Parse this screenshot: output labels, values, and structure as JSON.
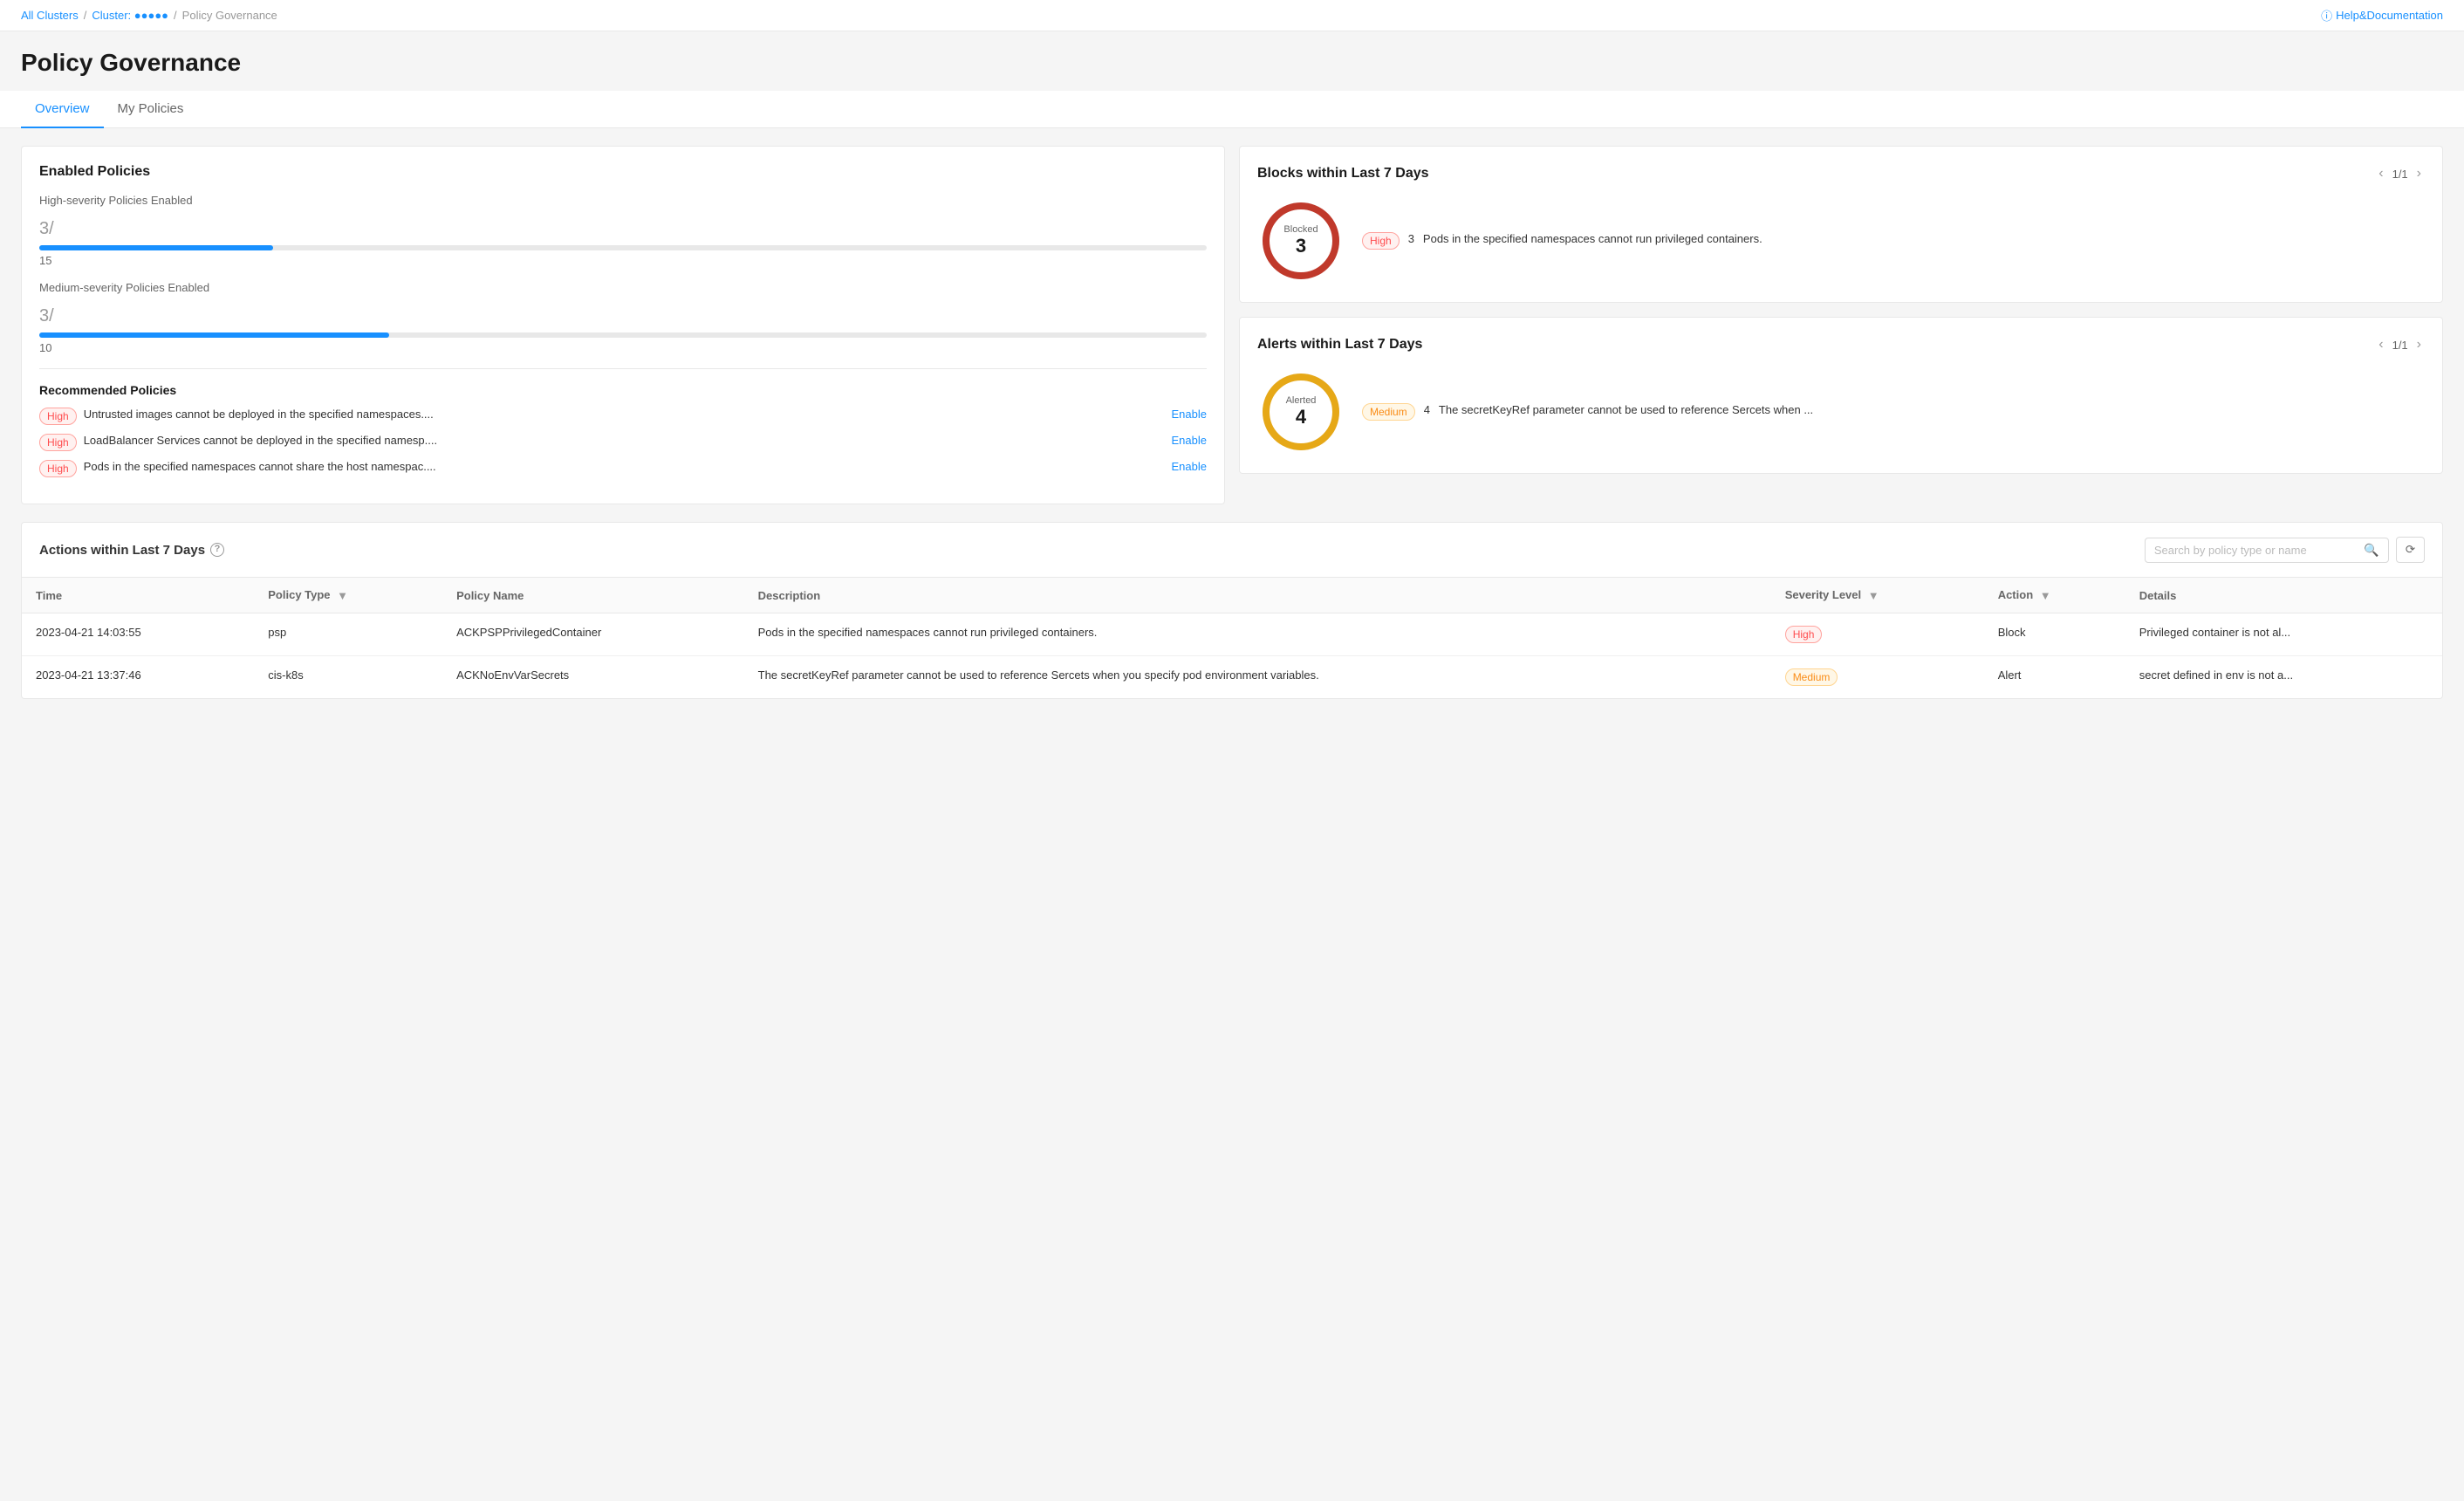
{
  "topbar": {
    "breadcrumb": [
      "All Clusters",
      "Cluster: ●●●●●",
      "Policy Governance"
    ],
    "help_text": "Help&Documentation"
  },
  "page": {
    "title": "Policy Governance",
    "tabs": [
      "Overview",
      "My Policies"
    ],
    "active_tab": "Overview"
  },
  "enabled_policies": {
    "section_title": "Enabled Policies",
    "high_label": "High-severity Policies Enabled",
    "high_count": "3",
    "high_separator": "/",
    "high_total": "15",
    "high_progress_pct": 20,
    "medium_label": "Medium-severity Policies Enabled",
    "medium_count": "3",
    "medium_separator": "/",
    "medium_total": "10",
    "medium_progress_pct": 30,
    "recommended_title": "Recommended Policies",
    "recommendations": [
      {
        "severity": "High",
        "text": "Untrusted images cannot be deployed in the specified namespaces....",
        "action": "Enable"
      },
      {
        "severity": "High",
        "text": "LoadBalancer Services cannot be deployed in the specified namesp....",
        "action": "Enable"
      },
      {
        "severity": "High",
        "text": "Pods in the specified namespaces cannot share the host namespac....",
        "action": "Enable"
      }
    ]
  },
  "blocks": {
    "title": "Blocks within Last 7 Days",
    "pagination": "1/1",
    "donut_label": "Blocked",
    "donut_count": "3",
    "donut_color": "#c0392b",
    "items": [
      {
        "severity": "High",
        "count": "3",
        "text": "Pods in the specified namespaces cannot run privileged containers."
      }
    ]
  },
  "alerts": {
    "title": "Alerts within Last 7 Days",
    "pagination": "1/1",
    "donut_label": "Alerted",
    "donut_count": "4",
    "donut_color": "#e6a817",
    "items": [
      {
        "severity": "Medium",
        "count": "4",
        "text": "The secretKeyRef parameter cannot be used to reference Sercets when ..."
      }
    ]
  },
  "actions": {
    "title": "Actions within Last 7 Days",
    "search_placeholder": "Search by policy type or name",
    "columns": [
      "Time",
      "Policy Type",
      "Policy Name",
      "Description",
      "Severity Level",
      "Action",
      "Details"
    ],
    "rows": [
      {
        "time": "2023-04-21 14:03:55",
        "policy_type": "psp",
        "policy_name": "ACKPSPPrivilegedContainer",
        "description": "Pods in the specified namespaces cannot run privileged containers.",
        "severity": "High",
        "action": "Block",
        "details": "Privileged container is not al..."
      },
      {
        "time": "2023-04-21 13:37:46",
        "policy_type": "cis-k8s",
        "policy_name": "ACKNoEnvVarSecrets",
        "description": "The secretKeyRef parameter cannot be used to reference Sercets when you specify pod environment variables.",
        "severity": "Medium",
        "action": "Alert",
        "details": "secret defined in env is not a..."
      }
    ]
  }
}
